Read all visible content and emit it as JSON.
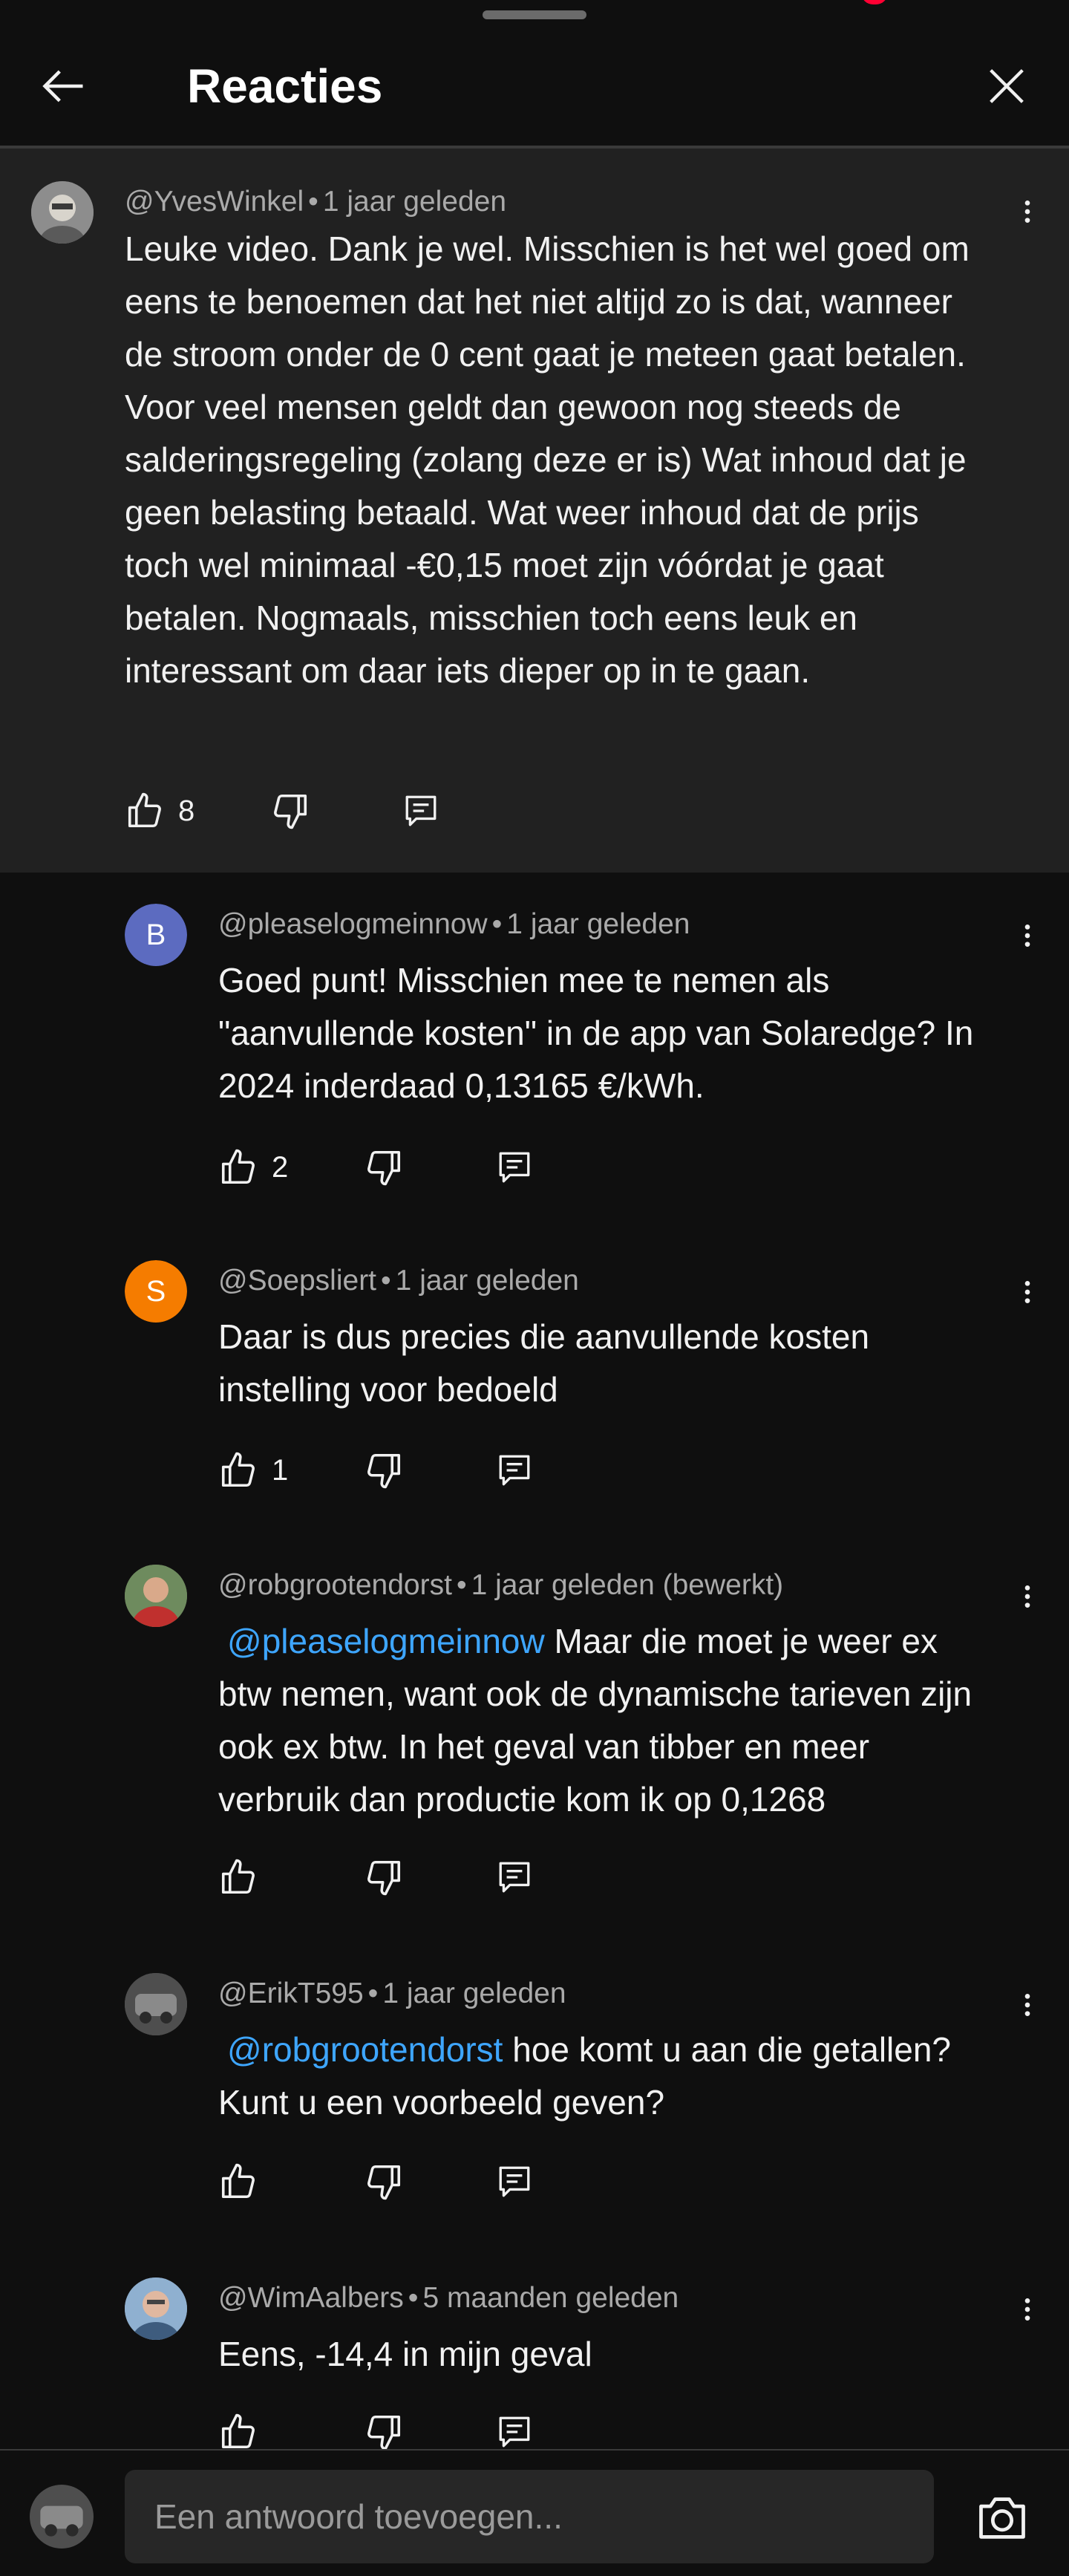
{
  "header": {
    "title": "Reacties"
  },
  "comments": [
    {
      "author": "@YvesWinkel",
      "time": "1 jaar geleden",
      "mention": "",
      "text": "Leuke video. Dank je wel. Misschien is het wel goed om eens te benoemen dat het niet altijd zo is dat, wanneer de stroom onder de 0 cent gaat je meteen gaat betalen. Voor veel mensen geldt dan gewoon nog steeds de salderingsregeling (zolang deze er is) Wat inhoud dat je geen belasting betaald. Wat weer inhoud dat de prijs toch wel minimaal -€0,15 moet zijn vóórdat je gaat betalen. Nogmaals, misschien toch eens leuk en interessant om daar iets dieper op in te gaan.",
      "likes": "8"
    },
    {
      "author": "@pleaselogmeinnow",
      "time": "1 jaar geleden",
      "avatar_letter": "B",
      "avatar_color": "#5c6bc0",
      "mention": "",
      "text": "Goed punt! Misschien mee te nemen als \"aanvullende kosten\" in de app van Solaredge? In 2024 inderdaad 0,13165 €/kWh.",
      "likes": "2"
    },
    {
      "author": "@Soepsliert",
      "time": "1 jaar geleden",
      "avatar_letter": "S",
      "avatar_color": "#f57c00",
      "mention": "",
      "text": "Daar is dus precies die aanvullende kosten instelling voor bedoeld",
      "likes": "1"
    },
    {
      "author": "@robgrootendorst",
      "time": "1 jaar geleden (bewerkt)",
      "mention": "@pleaselogmeinnow",
      "text": " Maar die moet je weer ex btw nemen, want ook de dynamische tarieven zijn ook ex btw. In het geval van tibber en meer verbruik dan productie kom ik op 0,1268",
      "likes": ""
    },
    {
      "author": "@ErikT595",
      "time": "1 jaar geleden",
      "mention": "@robgrootendorst",
      "text": " hoe komt u aan die getallen?  Kunt u een voorbeeld geven?",
      "likes": ""
    },
    {
      "author": "@WimAalbers",
      "time": "5 maanden geleden",
      "mention": "",
      "text": "Eens, -14,4 in mijn geval",
      "likes": ""
    }
  ],
  "footer": {
    "reply_placeholder": "Een antwoord toevoegen..."
  },
  "icons": {
    "back": "arrow-left-icon",
    "close": "close-icon",
    "more": "more-vertical-icon",
    "like": "thumbs-up-icon",
    "dislike": "thumbs-down-icon",
    "reply": "reply-icon",
    "camera": "camera-icon"
  },
  "colors": {
    "background": "#0f0f0f",
    "highlight": "#212121",
    "mention": "#3ea6ff",
    "meta": "#aaaaaa",
    "notification": "#ff0033"
  }
}
